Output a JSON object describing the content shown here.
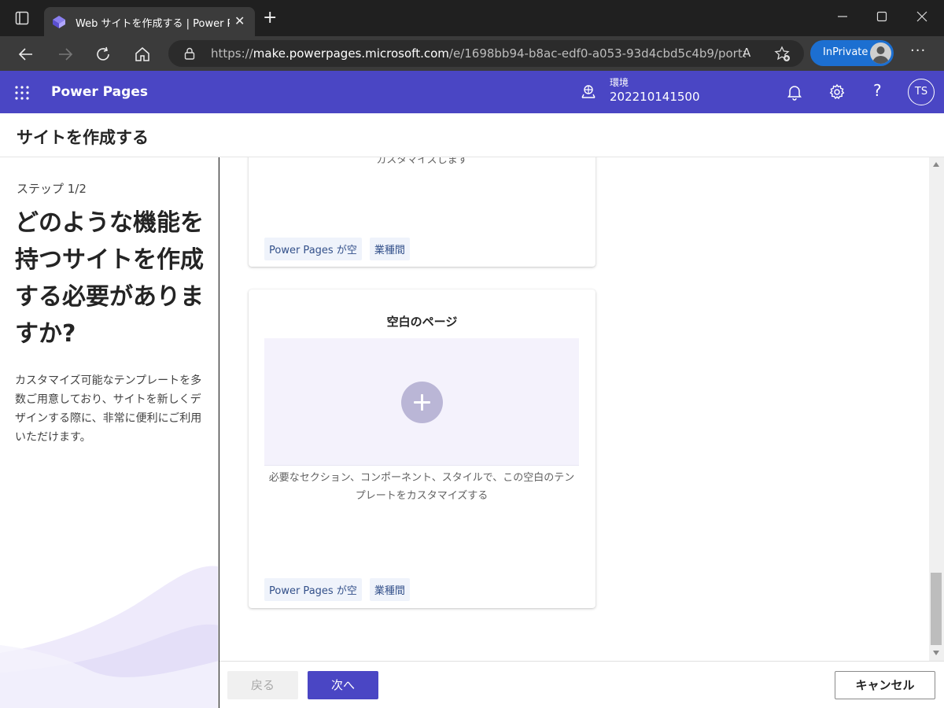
{
  "browser": {
    "tab_title": "Web サイトを作成する | Power Pages",
    "tab_close": "✕",
    "new_tab": "+",
    "url_prefix": "https://",
    "url_domain": "make.powerpages.microsoft.com",
    "url_path": "/e/1698bb94-b8ac-edf0-a053-93d4cbd5c4b9/portals...",
    "read_aloud": "A",
    "inprivate_label": "InPrivate",
    "more": "···"
  },
  "app": {
    "title": "Power Pages",
    "env_label": "環境",
    "env_value": "202210141500",
    "help": "?",
    "avatar_initials": "TS",
    "brand_color": "#4a46c4"
  },
  "page": {
    "title": "サイトを作成する"
  },
  "left": {
    "step": "ステップ 1/2",
    "question": "どのような機能を持つサイトを作成する必要がありますか?",
    "description": "カスタマイズ可能なテンプレートを多数ご用意しており、サイトを新しくデザインする際に、非常に便利にご利用いただけます。"
  },
  "cards": [
    {
      "partial_text": "カスタマイズします",
      "tags": [
        "Power Pages が空",
        "業種間"
      ]
    },
    {
      "title": "空白のページ",
      "description": "必要なセクション、コンポーネント、スタイルで、この空白のテンプレートをカスタマイズする",
      "tags": [
        "Power Pages が空",
        "業種間"
      ]
    }
  ],
  "footer": {
    "back": "戻る",
    "next": "次へ",
    "cancel": "キャンセル"
  }
}
